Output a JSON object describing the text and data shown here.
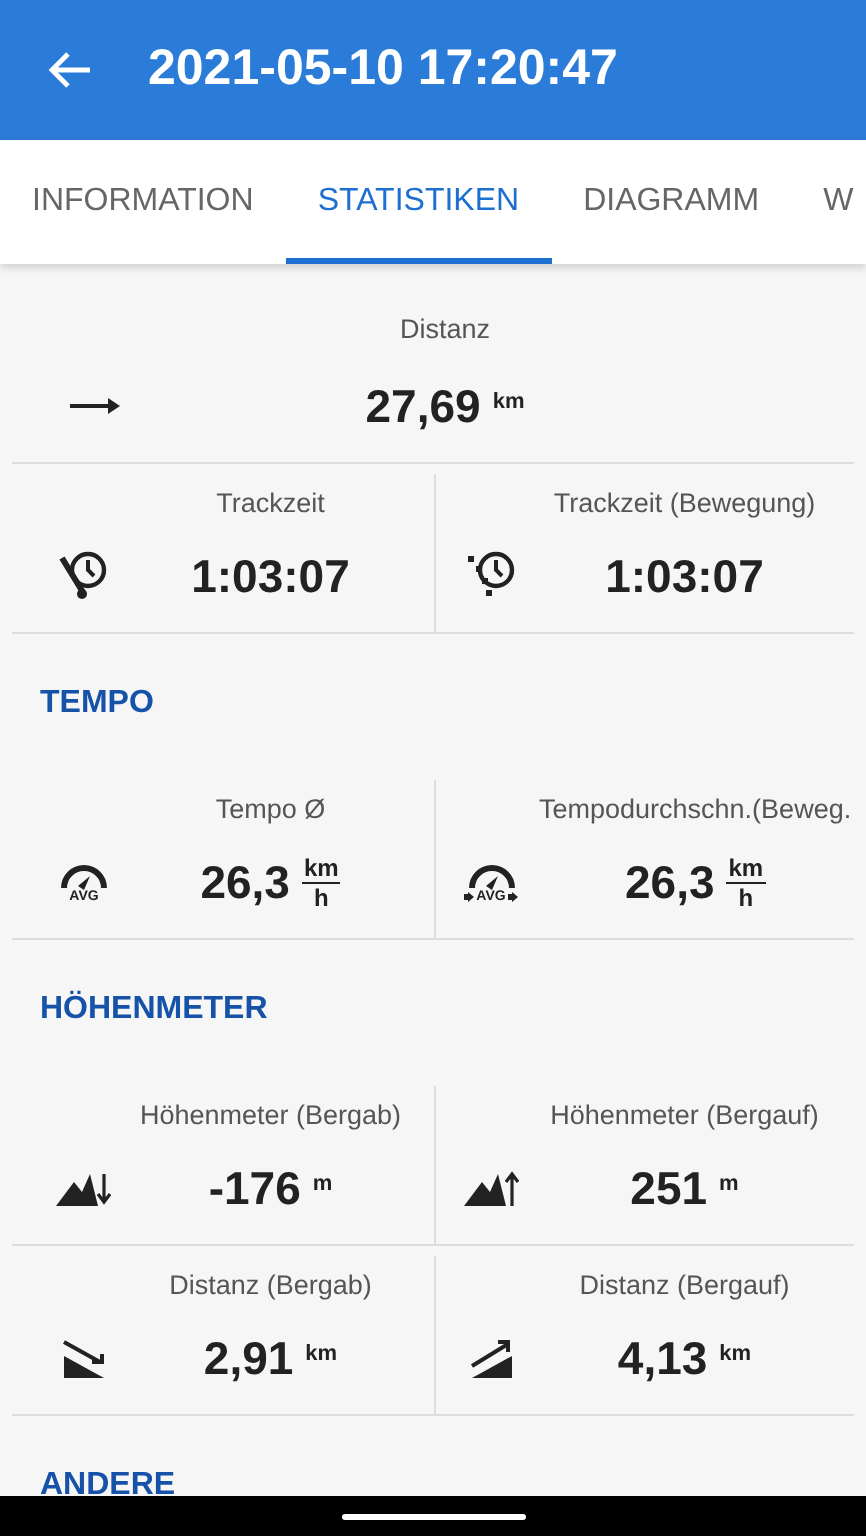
{
  "header": {
    "title": "2021-05-10 17:20:47"
  },
  "tabs": [
    {
      "label": "INFORMATION",
      "selected": false
    },
    {
      "label": "STATISTIKEN",
      "selected": true
    },
    {
      "label": "DIAGRAMM",
      "selected": false
    },
    {
      "label": "W",
      "selected": false
    }
  ],
  "sections": [
    {
      "rows": [
        [
          {
            "kind": "distance",
            "label": "Distanz",
            "value": "27,69",
            "unit": "km"
          }
        ],
        [
          {
            "kind": "tracktime",
            "label": "Trackzeit",
            "value": "1:03:07"
          },
          {
            "kind": "tracktime_moving",
            "label": "Trackzeit (Bewegung)",
            "value": "1:03:07"
          }
        ]
      ]
    },
    {
      "title": "TEMPO",
      "rows": [
        [
          {
            "kind": "avg_speed",
            "label": "Tempo Ø",
            "value": "26,3",
            "unit_top": "km",
            "unit_bottom": "h",
            "icon_text": "AVG"
          },
          {
            "kind": "avg_speed_moving",
            "label": "Tempodurchschn.(Beweg.",
            "value": "26,3",
            "unit_top": "km",
            "unit_bottom": "h",
            "icon_text": "AVG"
          }
        ]
      ]
    },
    {
      "title": "HÖHENMETER",
      "rows": [
        [
          {
            "kind": "descent",
            "label": "Höhenmeter (Bergab)",
            "value": "-176",
            "unit": "m"
          },
          {
            "kind": "ascent",
            "label": "Höhenmeter (Bergauf)",
            "value": "251",
            "unit": "m"
          }
        ],
        [
          {
            "kind": "distance_down",
            "label": "Distanz (Bergab)",
            "value": "2,91",
            "unit": "km"
          },
          {
            "kind": "distance_up",
            "label": "Distanz (Bergauf)",
            "value": "4,13",
            "unit": "km"
          }
        ]
      ]
    },
    {
      "title": "ANDERE"
    }
  ]
}
